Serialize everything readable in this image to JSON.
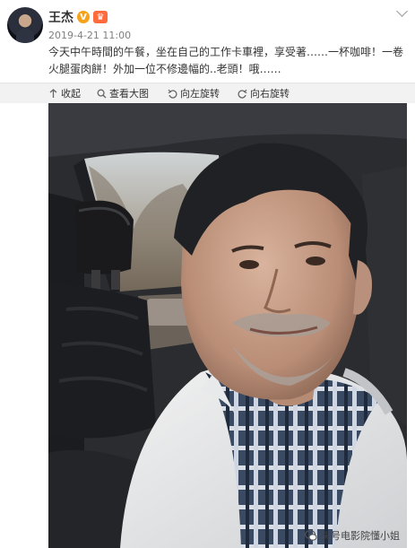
{
  "post": {
    "username": "王杰",
    "vip_badge": "V",
    "crown_badge": "♛",
    "timestamp": "2019-4-21 11:00",
    "text": "今天中午時間的午餐，坐在自己的工作卡車裡，享受著……一杯咖啡！一卷火腿蛋肉餅！外加一位不修邊幅的..老頭！哦……"
  },
  "toolbar": {
    "collect_label": "收起",
    "view_large_label": "查看大图",
    "rotate_left_label": "向左旋转",
    "rotate_right_label": "向右旋转"
  },
  "watermark": {
    "text": "头号电影院懂小姐"
  }
}
